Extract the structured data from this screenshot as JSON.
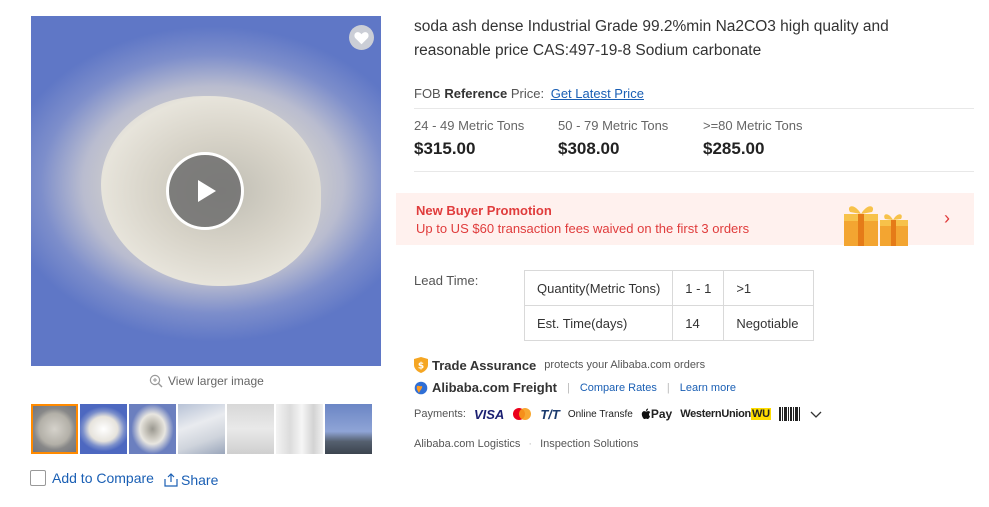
{
  "gallery": {
    "view_larger": "View larger image",
    "thumbnails": [
      "thumb-1",
      "thumb-2",
      "thumb-3",
      "thumb-4",
      "thumb-5",
      "thumb-6",
      "thumb-7"
    ],
    "add_to_compare": "Add to Compare",
    "share": "Share"
  },
  "product": {
    "title": "soda ash dense Industrial Grade 99.2%min Na2CO3 high quality and reasonable price CAS:497-19-8 Sodium carbonate",
    "fob_prefix": "FOB",
    "fob_reference": "Reference",
    "fob_price_label": "Price:",
    "latest_price_link": "Get Latest Price",
    "tiers": [
      {
        "quantity": "24 - 49 Metric Tons",
        "price": "$315.00"
      },
      {
        "quantity": "50 - 79 Metric Tons",
        "price": "$308.00"
      },
      {
        "quantity": ">=80 Metric Tons",
        "price": "$285.00"
      }
    ]
  },
  "promotion": {
    "heading": "New Buyer Promotion",
    "subtext": "Up to US $60 transaction fees waived on the first 3 orders",
    "arrow": "›"
  },
  "lead_time": {
    "label": "Lead Time:",
    "rows": [
      [
        "Quantity(Metric Tons)",
        "1 - 1",
        ">1"
      ],
      [
        "Est. Time(days)",
        "14",
        "Negotiable"
      ]
    ]
  },
  "services": {
    "trade_assurance_title": "Trade Assurance",
    "trade_assurance_text": "protects your Alibaba.com orders",
    "freight_title": "Alibaba.com Freight",
    "compare_rates": "Compare Rates",
    "learn_more": "Learn more",
    "payments_label": "Payments:",
    "payment_methods": [
      "VISA",
      "T/T",
      "Online Transfe",
      "Pay",
      "WesternUnion",
      "WU"
    ],
    "logistics": "Alibaba.com Logistics",
    "inspection": "Inspection Solutions"
  },
  "colors": {
    "link": "#1a5fb4",
    "promo_red": "#e03c3c",
    "promo_bg": "#fff1ee",
    "active_thumb": "#ff8a00"
  }
}
